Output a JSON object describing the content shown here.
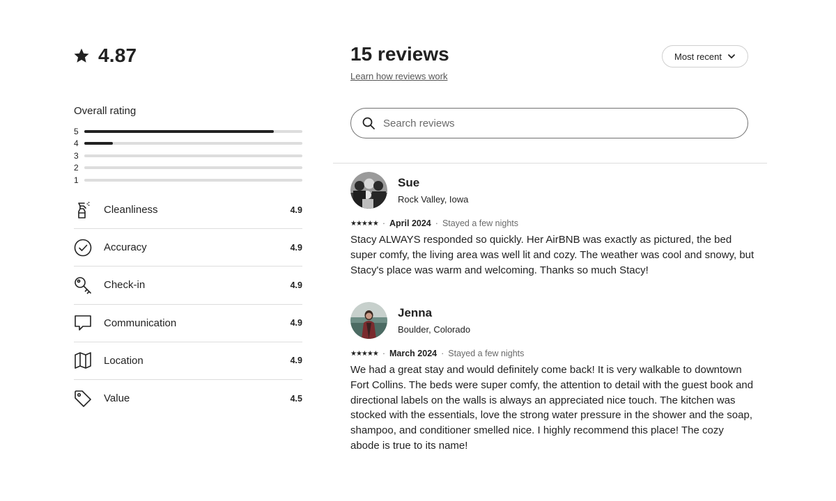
{
  "summary": {
    "rating": "4.87",
    "overall_label": "Overall rating",
    "distribution": [
      {
        "label": "5",
        "fraction": 0.87
      },
      {
        "label": "4",
        "fraction": 0.13
      },
      {
        "label": "3",
        "fraction": 0
      },
      {
        "label": "2",
        "fraction": 0
      },
      {
        "label": "1",
        "fraction": 0
      }
    ],
    "categories": [
      {
        "name": "Cleanliness",
        "value": "4.9",
        "icon": "spray-bottle-icon"
      },
      {
        "name": "Accuracy",
        "value": "4.9",
        "icon": "check-circle-icon"
      },
      {
        "name": "Check-in",
        "value": "4.9",
        "icon": "key-icon"
      },
      {
        "name": "Communication",
        "value": "4.9",
        "icon": "chat-bubble-icon"
      },
      {
        "name": "Location",
        "value": "4.9",
        "icon": "map-icon"
      },
      {
        "name": "Value",
        "value": "4.5",
        "icon": "price-tag-icon"
      }
    ]
  },
  "header": {
    "title": "15 reviews",
    "learn_link": "Learn how reviews work",
    "sort_label": "Most recent"
  },
  "search": {
    "placeholder": "Search reviews"
  },
  "reviews": [
    {
      "name": "Sue",
      "location": "Rock Valley, Iowa",
      "stars": "★★★★★",
      "date": "April 2024",
      "stay": "Stayed a few nights",
      "text": "Stacy ALWAYS responded so quickly. Her AirBNB was exactly as pictured, the bed super comfy, the living area was well lit and cozy. The weather was cool and snowy, but Stacy's place was warm and welcoming. Thanks so much Stacy!"
    },
    {
      "name": "Jenna",
      "location": "Boulder, Colorado",
      "stars": "★★★★★",
      "date": "March 2024",
      "stay": "Stayed a few nights",
      "text": "We had a great stay and would definitely come back! It is very walkable to downtown Fort Collins. The beds were super comfy, the attention to detail with the guest book and directional labels on the walls is always an appreciated nice touch. The kitchen was stocked with the essentials, love the strong water pressure in the shower and the soap, shampoo, and conditioner smelled nice. I highly recommend this place! The cozy abode is true to its name!"
    }
  ],
  "colors": {
    "text": "#222222",
    "muted": "#6a6a6a",
    "divider": "#dddddd",
    "bar_fill": "#222222",
    "bar_track": "#dddddd"
  }
}
